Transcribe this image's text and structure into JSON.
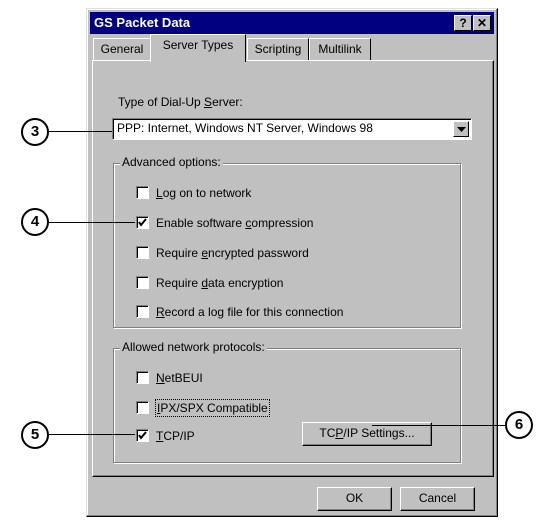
{
  "window": {
    "title": "GS Packet Data",
    "help_btn": "?",
    "close_btn": "✕"
  },
  "tabs": [
    {
      "label": "General"
    },
    {
      "label": "Server Types"
    },
    {
      "label": "Scripting"
    },
    {
      "label": "Multilink"
    }
  ],
  "server_type": {
    "label_pre": "Type of Dial-Up ",
    "label_ul": "S",
    "label_post": "erver:",
    "value": "PPP: Internet, Windows NT Server, Windows 98"
  },
  "advanced": {
    "title": "Advanced options:",
    "items": [
      {
        "pre": "",
        "ul": "L",
        "post": "og on to network",
        "checked": false
      },
      {
        "pre": "Enable software ",
        "ul": "c",
        "post": "ompression",
        "checked": true
      },
      {
        "pre": "Require ",
        "ul": "e",
        "post": "ncrypted password",
        "checked": false
      },
      {
        "pre": "Require ",
        "ul": "d",
        "post": "ata encryption",
        "checked": false
      },
      {
        "pre": "",
        "ul": "R",
        "post": "ecord a log file for this connection",
        "checked": false
      }
    ]
  },
  "protocols": {
    "title": "Allowed network protocols:",
    "items": [
      {
        "pre": "",
        "ul": "N",
        "post": "etBEUI",
        "checked": false
      },
      {
        "pre": "",
        "ul": "I",
        "post": "PX/SPX Compatible",
        "checked": false
      },
      {
        "pre": "",
        "ul": "T",
        "post": "CP/IP",
        "checked": true
      }
    ],
    "settings_btn": {
      "pre": "TC",
      "ul": "P",
      "post": "/IP Settings..."
    }
  },
  "buttons": {
    "ok": "OK",
    "cancel": "Cancel"
  },
  "callouts": [
    "3",
    "4",
    "5",
    "6"
  ]
}
